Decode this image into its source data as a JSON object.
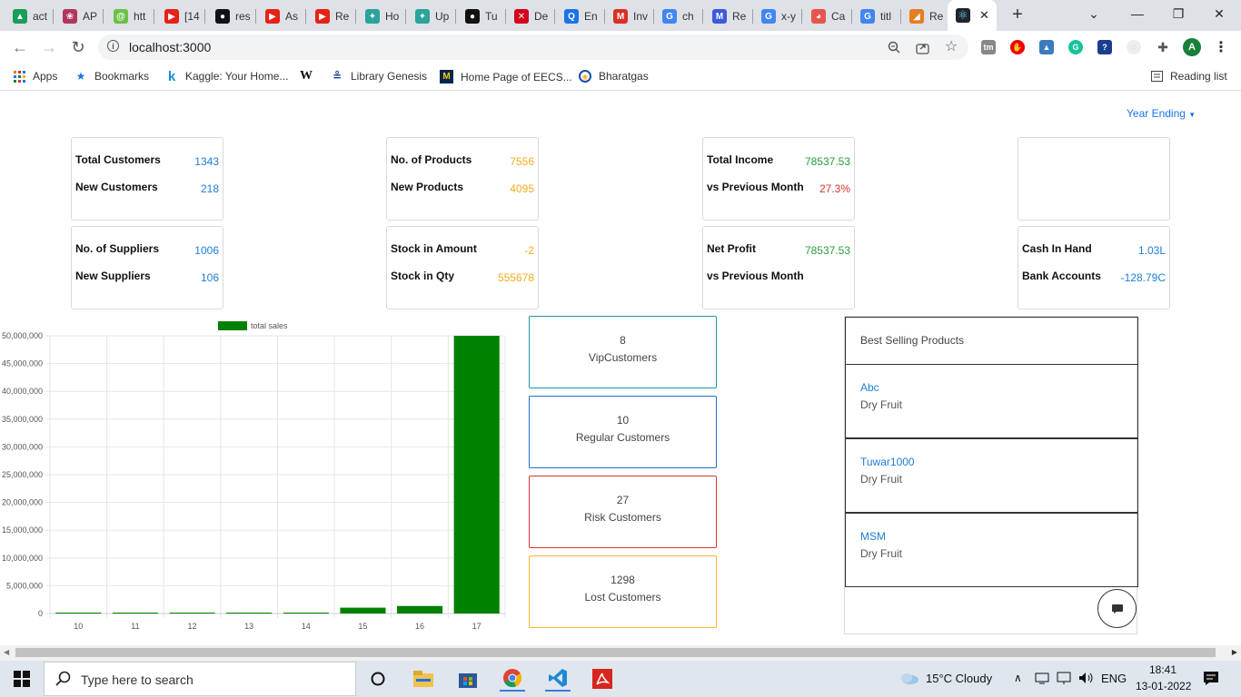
{
  "browser": {
    "tabs": [
      {
        "label": "act",
        "color": "#1a9c5b",
        "glyph": "▲"
      },
      {
        "label": "AP",
        "color": "#b2365c",
        "glyph": "❀"
      },
      {
        "label": "htt",
        "color": "#6cc04a",
        "glyph": "@"
      },
      {
        "label": "[14",
        "color": "#e62117",
        "glyph": "▶"
      },
      {
        "label": "res",
        "color": "#111",
        "glyph": "●"
      },
      {
        "label": "As",
        "color": "#e62117",
        "glyph": "▶"
      },
      {
        "label": "Re",
        "color": "#e62117",
        "glyph": "▶"
      },
      {
        "label": "Ho",
        "color": "#2aa39a",
        "glyph": "✦"
      },
      {
        "label": "Up",
        "color": "#2aa39a",
        "glyph": "✦"
      },
      {
        "label": "Tu",
        "color": "#111",
        "glyph": "●"
      },
      {
        "label": "De",
        "color": "#d0021b",
        "glyph": "✕"
      },
      {
        "label": "En",
        "color": "#1a73e8",
        "glyph": "Q"
      },
      {
        "label": "Inv",
        "color": "#d93025",
        "glyph": "M"
      },
      {
        "label": "ch",
        "color": "#4285f4",
        "glyph": "G"
      },
      {
        "label": "Re",
        "color": "#3b5bdb",
        "glyph": "M"
      },
      {
        "label": "x-y",
        "color": "#4285f4",
        "glyph": "G"
      },
      {
        "label": "Ca",
        "color": "#e8554e",
        "glyph": "◕"
      },
      {
        "label": "titl",
        "color": "#4285f4",
        "glyph": "G"
      },
      {
        "label": "Re",
        "color": "#e67e22",
        "glyph": "◢"
      }
    ],
    "active_tab_label": "",
    "url": "localhost:3000",
    "bookmarks": [
      {
        "label": "Apps",
        "icon": "apps-grid-icon"
      },
      {
        "label": "Bookmarks",
        "icon": "star-icon"
      },
      {
        "label": "Kaggle: Your Home...",
        "icon": "kaggle-icon"
      },
      {
        "label": "",
        "icon": "wikipedia-icon"
      },
      {
        "label": "Library Genesis",
        "icon": "libgen-icon"
      },
      {
        "label": "Home Page of EECS...",
        "icon": "umich-icon"
      },
      {
        "label": "Bharatgas",
        "icon": "bharatgas-icon"
      }
    ],
    "reading_list": "Reading list",
    "profile_initial": "A",
    "new_tab_symbol": "+",
    "wiki_glyph": "W"
  },
  "dashboard": {
    "year_ending": "Year Ending",
    "cards": [
      {
        "r1_label": "Total Customers",
        "r1_value": "1343",
        "r2_label": "New Customers",
        "r2_value": "218"
      },
      {
        "r1_label": "No. of Products",
        "r1_value": "7556",
        "r2_label": "New Products",
        "r2_value": "4095"
      },
      {
        "r1_label": "Total Income",
        "r1_value": "78537.53",
        "r2_label": "vs Previous Month",
        "r2_value": "27.3%"
      },
      {
        "r1_label": "",
        "r1_value": "",
        "r2_label": "",
        "r2_value": ""
      },
      {
        "r1_label": "No. of Suppliers",
        "r1_value": "1006",
        "r2_label": "New Suppliers",
        "r2_value": "106"
      },
      {
        "r1_label": "Stock in Amount",
        "r1_value": "-2",
        "r2_label": "Stock in Qty",
        "r2_value": "555678"
      },
      {
        "r1_label": "Net Profit",
        "r1_value": "78537.53",
        "r2_label": "vs Previous Month",
        "r2_value": ""
      },
      {
        "r1_label": "Cash In Hand",
        "r1_value": "1.03L",
        "r2_label": "Bank Accounts",
        "r2_value": "-128.79C"
      }
    ],
    "segments": [
      {
        "count": "8",
        "label": "VipCustomers",
        "border": "#1a9aa8"
      },
      {
        "count": "10",
        "label": "Regular Customers",
        "border": "#1e6fd1"
      },
      {
        "count": "27",
        "label": "Risk Customers",
        "border": "#d93636"
      },
      {
        "count": "1298",
        "label": "Lost Customers",
        "border": "#f2b632"
      }
    ],
    "best_selling": {
      "title": "Best Selling Products",
      "items": [
        {
          "name": "Abc",
          "category": "Dry Fruit"
        },
        {
          "name": "Tuwar1000",
          "category": "Dry Fruit"
        },
        {
          "name": "MSM",
          "category": "Dry Fruit"
        }
      ]
    }
  },
  "chart_data": {
    "type": "bar",
    "categories": [
      "10",
      "11",
      "12",
      "13",
      "14",
      "15",
      "16",
      "17"
    ],
    "series": [
      {
        "name": "total sales",
        "values": [
          100000,
          150000,
          20000,
          20000,
          50000,
          1050000,
          1350000,
          50000000
        ],
        "color": "#008000"
      }
    ],
    "ylim": [
      0,
      50000000
    ],
    "yticks": [
      0,
      5000000,
      10000000,
      15000000,
      20000000,
      25000000,
      30000000,
      35000000,
      40000000,
      45000000,
      50000000
    ],
    "ytick_labels": [
      "0",
      "5,000,000",
      "10,000,000",
      "15,000,000",
      "20,000,000",
      "25,000,000",
      "30,000,000",
      "35,000,000",
      "40,000,000",
      "45,000,000",
      "50,000,000"
    ],
    "grid": true,
    "legend": "top-center"
  },
  "taskbar": {
    "search_placeholder": "Type here to search",
    "weather": "15°C  Cloudy",
    "lang": "ENG",
    "time": "18:41",
    "date": "13-01-2022"
  }
}
